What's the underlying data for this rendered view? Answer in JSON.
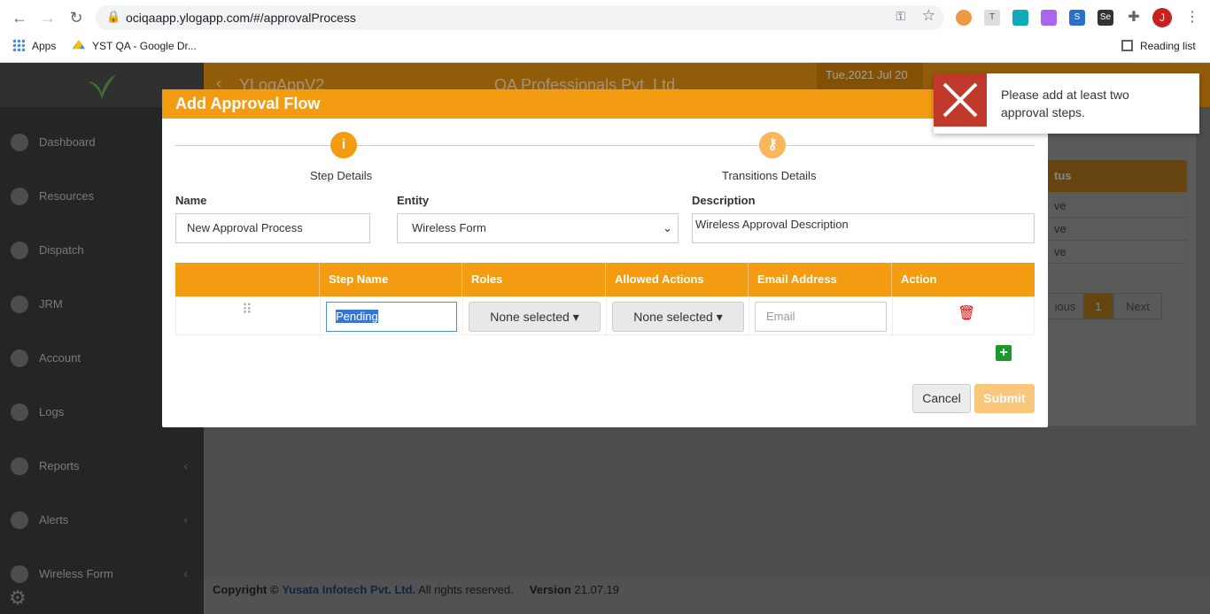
{
  "browser": {
    "url": "ociqaapp.ylogapp.com/#/approvalProcess",
    "profile_initial": "J",
    "bookmarks": [
      "Apps",
      "YST QA - Google Dr...",
      "Reading list"
    ]
  },
  "app": {
    "name": "YLogAppV2",
    "company": "QA Professionals Pvt. Ltd.",
    "date": "Tue,2021 Jul 20",
    "sidebar": {
      "items": [
        {
          "label": "Dashboard",
          "has_chevron": false
        },
        {
          "label": "Resources",
          "has_chevron": false
        },
        {
          "label": "Dispatch",
          "has_chevron": false
        },
        {
          "label": "JRM",
          "has_chevron": false
        },
        {
          "label": "Account",
          "has_chevron": false
        },
        {
          "label": "Logs",
          "has_chevron": false
        },
        {
          "label": "Reports",
          "has_chevron": true
        },
        {
          "label": "Alerts",
          "has_chevron": true
        },
        {
          "label": "Wireless Form",
          "has_chevron": true
        }
      ]
    },
    "background_table": {
      "header": "tus",
      "rows": [
        "ve",
        "ve",
        "ve"
      ],
      "pager": {
        "prev": "ious",
        "current": "1",
        "next": "Next"
      }
    },
    "footer": {
      "copyright_label": "Copyright ©",
      "company_link": "Yusata Infotech Pvt. Ltd.",
      "rights": "All rights reserved.",
      "version_label": "Version",
      "version": "21.07.19"
    }
  },
  "modal": {
    "title": "Add Approval Flow",
    "steps": [
      {
        "label": "Step Details",
        "icon": "info-icon"
      },
      {
        "label": "Transitions Details",
        "icon": "key-icon"
      }
    ],
    "fields": {
      "name_label": "Name",
      "name_value": "New Approval Process",
      "entity_label": "Entity",
      "entity_value": "Wireless Form",
      "description_label": "Description",
      "description_value": "Wireless Approval Description"
    },
    "table": {
      "columns": [
        "",
        "Step Name",
        "Roles",
        "Allowed Actions",
        "Email Address",
        "Action"
      ],
      "row": {
        "step_name": "Pending",
        "roles": "None selected",
        "allowed_actions": "None selected",
        "email_placeholder": "Email"
      }
    },
    "buttons": {
      "cancel": "Cancel",
      "submit": "Submit"
    }
  },
  "toast": {
    "message": "Please add at least two approval steps.",
    "icon": "error-x-icon"
  },
  "colors": {
    "accent": "#f39c12",
    "error": "#c0392b",
    "add": "#1a9a2a"
  }
}
